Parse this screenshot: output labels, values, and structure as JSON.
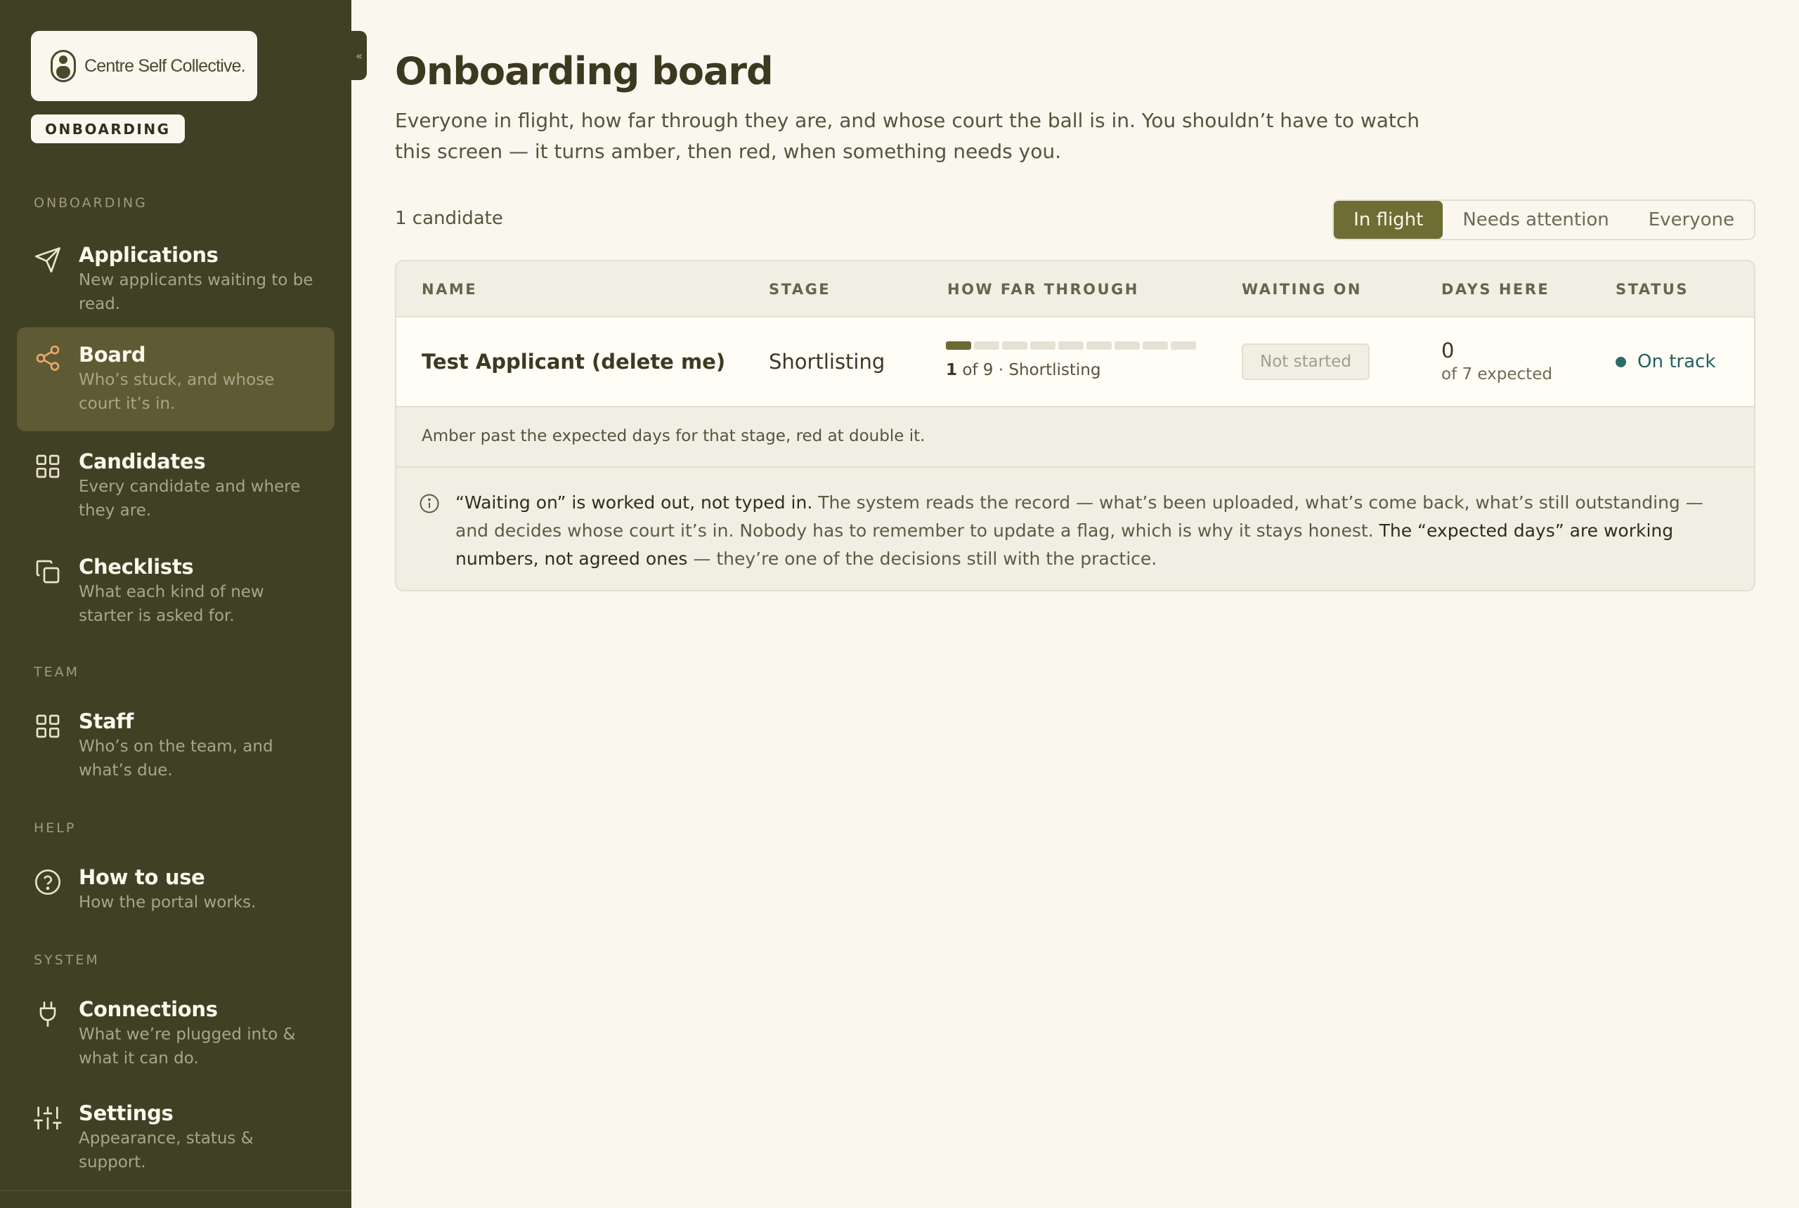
{
  "brand": {
    "name": "Centre Self Collective.",
    "role_badge": "ONBOARDING"
  },
  "sidebar": {
    "collapse_glyph": "«",
    "sections": [
      {
        "label": "ONBOARDING"
      },
      {
        "label": "TEAM"
      },
      {
        "label": "HELP"
      },
      {
        "label": "SYSTEM"
      }
    ],
    "items": [
      {
        "title": "Applications",
        "desc": "New applicants waiting to be read.",
        "icon": "send-icon"
      },
      {
        "title": "Board",
        "desc": "Who’s stuck, and whose court it’s in.",
        "icon": "share-icon",
        "active": true
      },
      {
        "title": "Candidates",
        "desc": "Every candidate and where they are.",
        "icon": "grid-icon"
      },
      {
        "title": "Checklists",
        "desc": "What each kind of new starter is asked for.",
        "icon": "copy-icon"
      },
      {
        "title": "Staff",
        "desc": "Who’s on the team, and what’s due.",
        "icon": "grid-icon"
      },
      {
        "title": "How to use",
        "desc": "How the portal works.",
        "icon": "help-circle-icon"
      },
      {
        "title": "Connections",
        "desc": "What we’re plugged into & what it can do.",
        "icon": "plug-icon"
      },
      {
        "title": "Settings",
        "desc": "Appearance, status & support.",
        "icon": "sliders-icon"
      }
    ]
  },
  "page": {
    "title": "Onboarding board",
    "intro": "Everyone in flight, how far through they are, and whose court the ball is in. You shouldn’t have to watch this screen — it turns amber, then red, when something needs you.",
    "count": "1 candidate",
    "filters": [
      "In flight",
      "Needs attention",
      "Everyone"
    ],
    "active_filter": "In flight"
  },
  "table": {
    "columns": [
      "NAME",
      "STAGE",
      "HOW FAR THROUGH",
      "WAITING ON",
      "DAYS HERE",
      "STATUS"
    ],
    "rows": [
      {
        "name": "Test Applicant (delete me)",
        "stage": "Shortlisting",
        "progress_done": 1,
        "progress_total": 9,
        "progress_current": "1",
        "progress_rest": "of 9 · Shortlisting",
        "waiting_on": "Not started",
        "days": "0",
        "days_sub": "of 7 expected",
        "status": "On track",
        "status_color": "#2f6b69"
      }
    ],
    "legend": "Amber past the expected days for that stage, red at double it."
  },
  "note": {
    "lead": "“Waiting on” is worked out, not typed in.",
    "body1": " The system reads the record — what’s been uploaded, what’s come back, what’s still outstanding — and decides whose court it’s in. Nobody has to remember to update a flag, which is why it stays honest. ",
    "lead2": "The “expected days” are working numbers, not agreed ones",
    "body2": " — they’re one of the decisions still with the practice."
  },
  "colors": {
    "sidebar_bg": "#3f4024",
    "accent": "#6e6d34",
    "page_bg": "#faf7ef",
    "status_on_track": "#2f6b69"
  }
}
